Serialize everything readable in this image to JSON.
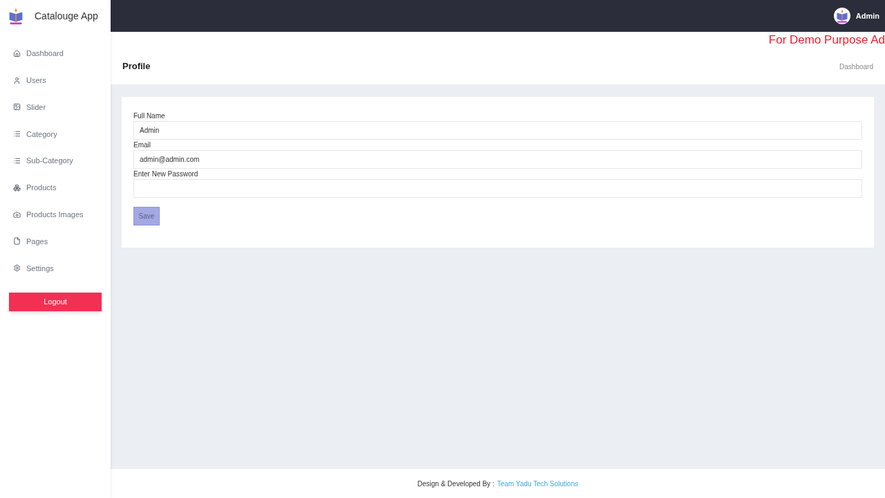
{
  "sidebar": {
    "brand": "Catalouge App",
    "items": [
      {
        "label": "Dashboard"
      },
      {
        "label": "Users"
      },
      {
        "label": "Slider"
      },
      {
        "label": "Category"
      },
      {
        "label": "Sub-Category"
      },
      {
        "label": "Products"
      },
      {
        "label": "Products Images"
      },
      {
        "label": "Pages"
      },
      {
        "label": "Settings"
      }
    ],
    "logout": "Logout"
  },
  "topbar": {
    "user": "Admin"
  },
  "notice": "For Demo Purpose Ad",
  "page": {
    "title": "Profile",
    "breadcrumb": "Dashboard"
  },
  "form": {
    "fields": [
      {
        "label": "Full Name",
        "value": "Admin"
      },
      {
        "label": "Email",
        "value": "admin@admin.com"
      },
      {
        "label": "Enter New Password"
      }
    ],
    "submit": {
      "label": "Save",
      "disabled": true
    }
  },
  "footer": {
    "text": "Design & Developed By :",
    "link": "Team Yadu Tech Solutions"
  }
}
